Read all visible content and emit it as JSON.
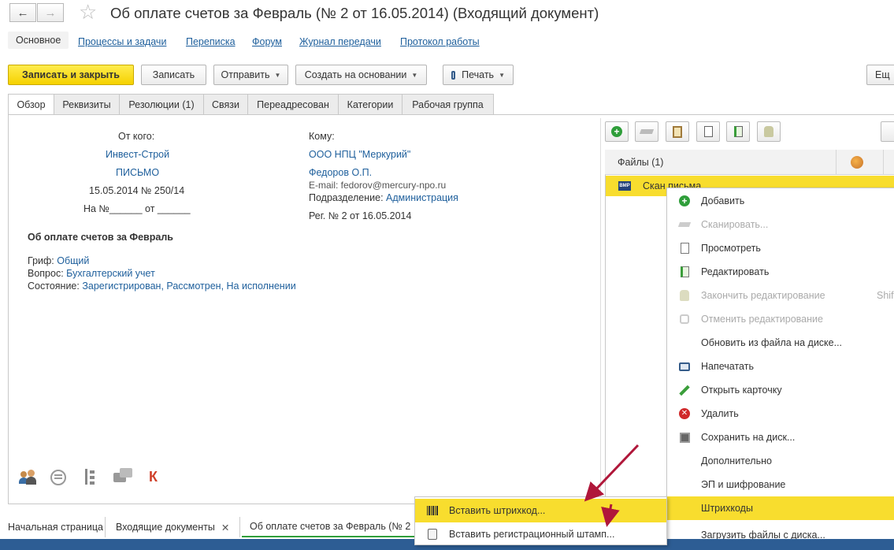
{
  "window": {
    "title": "Об оплате счетов за Февраль (№ 2 от 16.05.2014) (Входящий документ)"
  },
  "sections": [
    "Основное",
    "Процессы и задачи",
    "Переписка",
    "Форум",
    "Журнал передачи",
    "Протокол работы"
  ],
  "toolbar": {
    "save_close": "Записать и закрыть",
    "save": "Записать",
    "send": "Отправить",
    "create_based": "Создать на основании",
    "print": "Печать",
    "more": "Ещ"
  },
  "tabs": [
    "Обзор",
    "Реквизиты",
    "Резолюции (1)",
    "Связи",
    "Переадресован",
    "Категории",
    "Рабочая группа"
  ],
  "from": {
    "label": "От кого:",
    "org": "Инвест-Строй",
    "kind": "ПИСЬМО",
    "date_num": "15.05.2014 № 250/14",
    "ref": "На №______ от ______"
  },
  "to": {
    "label": "Кому:",
    "org": "ООО НПЦ \"Меркурий\"",
    "person": "Федоров О.П.",
    "email": "E-mail: fedorov@mercury-npo.ru",
    "dept_label": "Подразделение:",
    "dept": "Администрация",
    "reg": "Рег. № 2 от 16.05.2014"
  },
  "doc": {
    "subject": "Об оплате счетов за Февраль",
    "grif_label": "Гриф:",
    "grif": "Общий",
    "question_label": "Вопрос:",
    "question": "Бухгалтерский учет",
    "state_label": "Состояние:",
    "state": "Зарегистрирован, Рассмотрен, На исполнении"
  },
  "files": {
    "header": "Файлы (1)",
    "row_name": "Скан письма"
  },
  "context_menu": [
    {
      "label": "Добавить",
      "icon": "add-icon",
      "disabled": false
    },
    {
      "label": "Сканировать...",
      "icon": "scan-icon",
      "disabled": true
    },
    {
      "label": "Просмотреть",
      "icon": "view-icon",
      "disabled": false
    },
    {
      "label": "Редактировать",
      "icon": "edit-file-icon",
      "disabled": false
    },
    {
      "label": "Закончить редактирование",
      "icon": "finish-edit-icon",
      "disabled": true,
      "shortcut": "Shif"
    },
    {
      "label": "Отменить редактирование",
      "icon": "cancel-edit-icon",
      "disabled": true
    },
    {
      "label": "Обновить из файла на диске...",
      "icon": "",
      "disabled": false
    },
    {
      "label": "Напечатать",
      "icon": "print-icon",
      "disabled": false
    },
    {
      "label": "Открыть карточку",
      "icon": "pencil-icon",
      "disabled": false
    },
    {
      "label": "Удалить",
      "icon": "delete-icon",
      "disabled": false
    },
    {
      "label": "Сохранить на диск...",
      "icon": "save-disk-icon",
      "disabled": false
    },
    {
      "label": "Дополнительно",
      "icon": "",
      "disabled": false
    },
    {
      "label": "ЭП и шифрование",
      "icon": "",
      "disabled": false
    },
    {
      "label": "Штрихкоды",
      "icon": "",
      "disabled": false,
      "selected": true
    },
    {
      "label": "Загрузить файлы с диска...",
      "icon": "",
      "disabled": false
    }
  ],
  "submenu": [
    {
      "label": "Вставить штрихкод...",
      "icon": "barcode-icon",
      "selected": true
    },
    {
      "label": "Вставить регистрационный штамп...",
      "icon": "stamp-icon",
      "selected": false
    }
  ],
  "bottom_tabs": [
    "Начальная страница",
    "Входящие документы",
    "Об оплате счетов за Февраль (№ 2"
  ],
  "bottom_icons": {
    "k_letter": "К"
  },
  "colors": {
    "accent_yellow": "#f8dd2e",
    "link": "#1e5f9c",
    "arrow": "#b0173a"
  }
}
